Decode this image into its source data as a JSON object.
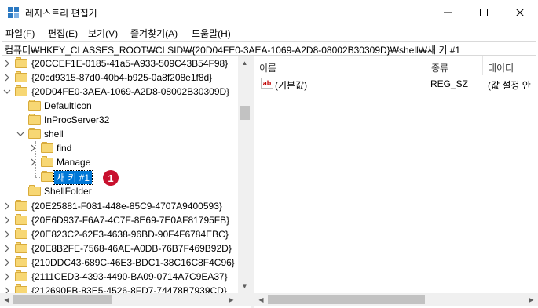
{
  "window": {
    "title": "레지스트리 편집기"
  },
  "menu": [
    {
      "label": "파일(F)"
    },
    {
      "label": "편집(E)"
    },
    {
      "label": "보기(V)"
    },
    {
      "label": "즐겨찾기(A)"
    },
    {
      "label": "도움말(H)"
    }
  ],
  "address": "컴퓨터₩HKEY_CLASSES_ROOT₩CLSID₩{20D04FE0-3AEA-1069-A2D8-08002B30309D}₩shell₩새 키 #1",
  "tree": {
    "items": [
      {
        "label": "{20CCEF1E-0185-41a5-A933-509C43B54F98}",
        "expander": "collapsed"
      },
      {
        "label": "{20cd9315-87d0-40b4-b925-0a8f208e1f8d}",
        "expander": "collapsed"
      },
      {
        "label": "{20D04FE0-3AEA-1069-A2D8-08002B30309D}",
        "expander": "expanded"
      },
      {
        "label": "DefaultIcon",
        "expander": "none"
      },
      {
        "label": "InProcServer32",
        "expander": "none"
      },
      {
        "label": "shell",
        "expander": "expanded"
      },
      {
        "label": "find",
        "expander": "collapsed"
      },
      {
        "label": "Manage",
        "expander": "collapsed"
      },
      {
        "label": "새 키 #1",
        "expander": "none",
        "selected": true
      },
      {
        "label": "ShellFolder",
        "expander": "none"
      },
      {
        "label": "{20E25881-F081-448e-85C9-4707A9400593}",
        "expander": "collapsed"
      },
      {
        "label": "{20E6D937-F6A7-4C7F-8E69-7E0AF81795FB}",
        "expander": "collapsed"
      },
      {
        "label": "{20E823C2-62F3-4638-96BD-90F4F6784EBC}",
        "expander": "collapsed"
      },
      {
        "label": "{20E8B2FE-7568-46AE-A0DB-76B7F469B92D}",
        "expander": "collapsed"
      },
      {
        "label": "{210DDC43-689C-46E3-BDC1-38C16C8F4C96}",
        "expander": "collapsed"
      },
      {
        "label": "{2111CED3-4393-4490-BA09-0714A7C9EA37}",
        "expander": "collapsed"
      },
      {
        "label": "{212690FB-83E5-4526-8FD7-74478B7939CD}",
        "expander": "collapsed"
      }
    ]
  },
  "list": {
    "columns": [
      "이름",
      "종류",
      "데이터"
    ],
    "rows": [
      {
        "icon": "ab",
        "name": "(기본값)",
        "type": "REG_SZ",
        "data": "(값 설정 안"
      }
    ]
  },
  "annotation": {
    "number": "1"
  },
  "colors": {
    "selection": "#0078d7",
    "folder": "#f7d774",
    "badge": "#c8102e"
  }
}
